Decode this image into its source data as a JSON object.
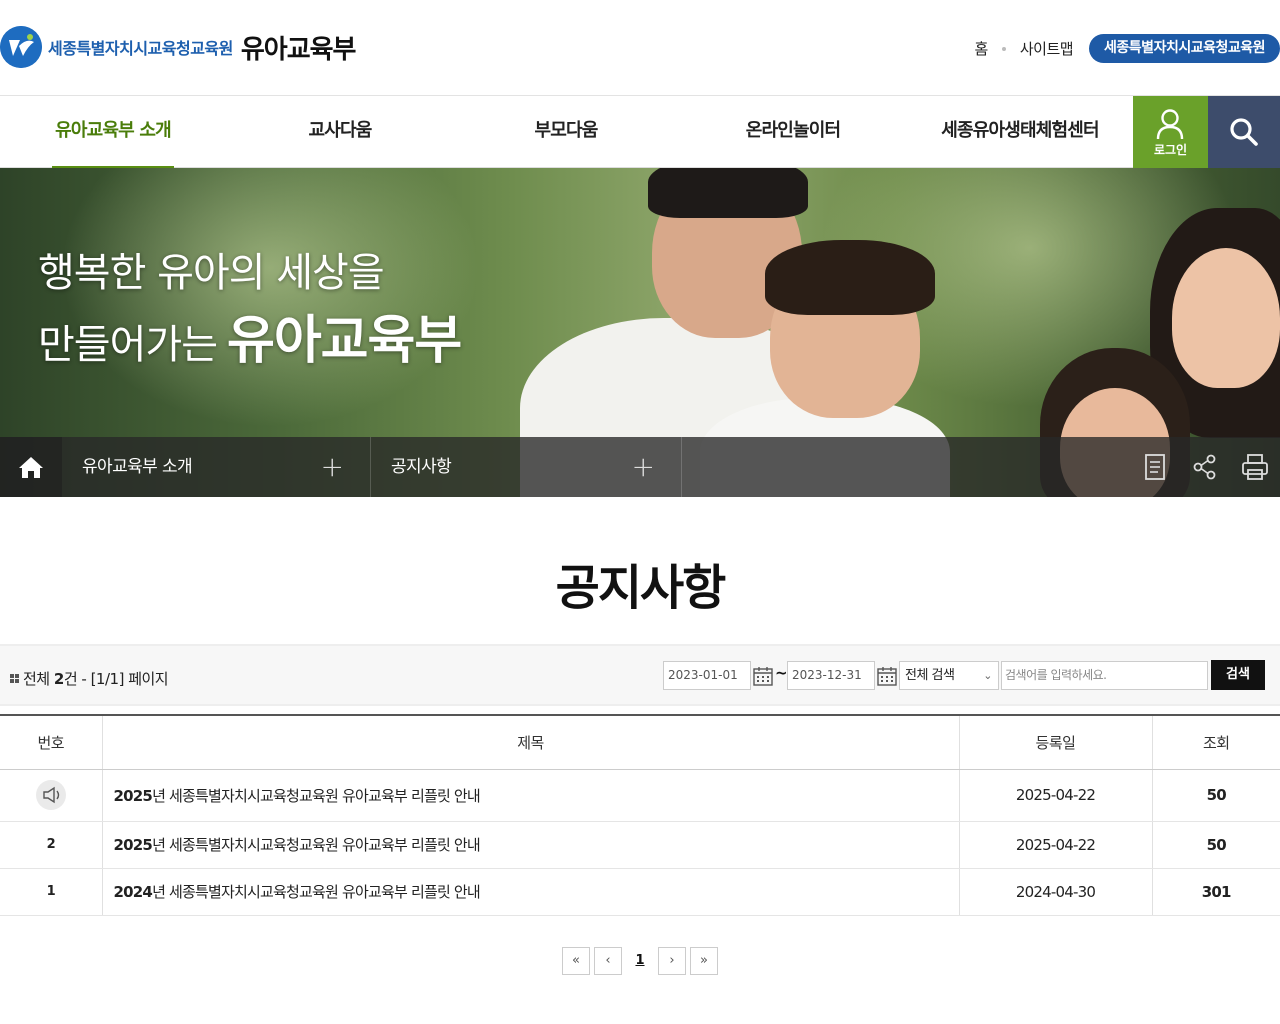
{
  "header": {
    "org_name": "세종특별자치시교육청교육원",
    "site_title": "유아교육부",
    "util": {
      "home": "홈",
      "sitemap": "사이트맵",
      "org_button": "세종특별자치시교육청교육원"
    }
  },
  "gnb": {
    "items": [
      {
        "label": "유아교육부 소개",
        "active": true
      },
      {
        "label": "교사다움",
        "active": false
      },
      {
        "label": "부모다움",
        "active": false
      },
      {
        "label": "온라인놀이터",
        "active": false
      },
      {
        "label": "세종유아생태체험센터",
        "active": false
      }
    ],
    "login_label": "로그인",
    "accent_color": "#6aa12a",
    "search_bg": "#3d4c6b"
  },
  "visual": {
    "line1": "행복한 유아의 세상을",
    "line2": "만들어가는",
    "line2_strong": "유아교육부"
  },
  "location": {
    "depth1": "유아교육부 소개",
    "depth2": "공지사항",
    "tools": [
      "document-icon",
      "share-icon",
      "print-icon"
    ]
  },
  "page_title": "공지사항",
  "search": {
    "total_prefix": "전체",
    "total_count": "2",
    "total_suffix": "건 - [1/1] 페이지",
    "date_from": "2023-01-01",
    "date_to": "2023-12-31",
    "tilde": "~",
    "select_value": "전체 검색",
    "keyword_placeholder": "검색어를 입력하세요.",
    "button": "검색"
  },
  "table": {
    "headers": [
      "번호",
      "제목",
      "등록일",
      "조회"
    ],
    "rows": [
      {
        "num": "",
        "notice": true,
        "year": "2025",
        "title": "년 세종특별자치시교육청교육원 유아교육부 리플릿 안내",
        "date": "2025-04-22",
        "hits": "50"
      },
      {
        "num": "2",
        "notice": false,
        "year": "2025",
        "title": "년 세종특별자치시교육청교육원 유아교육부 리플릿 안내",
        "date": "2025-04-22",
        "hits": "50"
      },
      {
        "num": "1",
        "notice": false,
        "year": "2024",
        "title": "년 세종특별자치시교육청교육원 유아교육부 리플릿 안내",
        "date": "2024-04-30",
        "hits": "301"
      }
    ]
  },
  "paging": {
    "first": "«",
    "prev": "‹",
    "current": "1",
    "next": "›",
    "last": "»"
  }
}
